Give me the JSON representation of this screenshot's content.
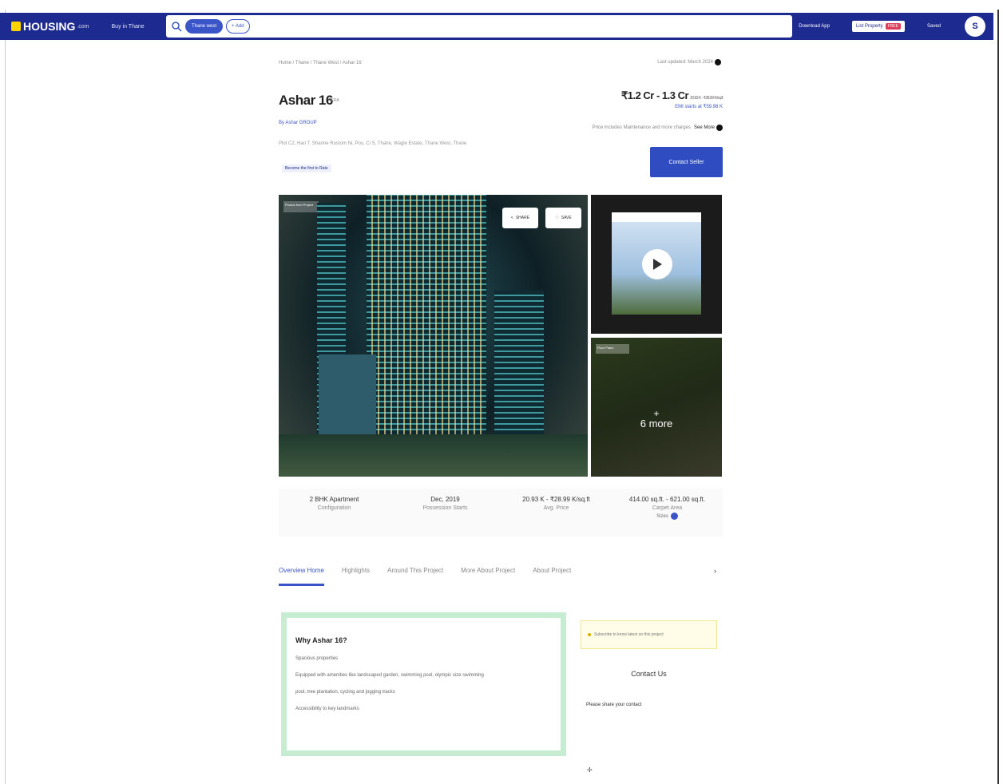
{
  "header": {
    "logo_text": "HOUSING",
    "logo_suffix": ".com",
    "city_selector": "Buy in Thane",
    "search_chip": "Thane west",
    "search_add": "+ Add",
    "download_app": "Download App",
    "list_property": "List Property",
    "free_badge": "FREE",
    "saved": "Saved",
    "avatar_letter": "S",
    "brand_color": "#1d2a8f"
  },
  "breadcrumb": "Home / Thane / Thane West / Ashar 16",
  "last_updated": "Last updated: March 2024",
  "project": {
    "name": "Ashar 16",
    "rera": "RERA",
    "builder": "By Ashar GROUP",
    "address": "Plot C2, Hari T. Shanne Rustom Ni, Pos, Ci S, Thane, Wagle Estate, Thane West, Thane",
    "rate_cta": "Become the first to Rate",
    "price_range": "₹1.2 Cr - 1.3 Cr",
    "price_per_sqft": "20.93 K - ₹28.99 K/sq.ft",
    "emi": "EMI starts at ₹59.98 K",
    "possession_note": "Price includes Maintenance and more charges",
    "see_more": "See More",
    "contact_button": "Contact Seller"
  },
  "gallery": {
    "photo_tag": "Photos from Project",
    "share": "SHARE",
    "save": "SAVE",
    "more_tag": "Floor Plans",
    "more_count": "6 more"
  },
  "stats": [
    {
      "value": "2 BHK Apartment",
      "label": "Configuration"
    },
    {
      "value": "Dec, 2019",
      "label": "Possession Starts"
    },
    {
      "value": "20.93 K - ₹28.99 K/sq.ft",
      "label": "Avg. Price"
    },
    {
      "value": "414.00 sq.ft. - 621.00 sq.ft.",
      "label": "Carpet Area",
      "extra": "Sizes"
    }
  ],
  "tabs": [
    "Overview Home",
    "Highlights",
    "Around This Project",
    "More About Project",
    "About Project"
  ],
  "why": {
    "title": "Why Ashar 16?",
    "points": [
      "Spacious properties",
      "Equipped with amenities like landscaped garden, swimming pool, olympic size swimming",
      "pool, tree plantation, cycling and jogging tracks",
      "Accessibility to key landmarks"
    ]
  },
  "sidebar": {
    "notice": "Subscribe to know latest on this project",
    "contact_title": "Contact Us",
    "contact_note": "Please share your contact"
  }
}
